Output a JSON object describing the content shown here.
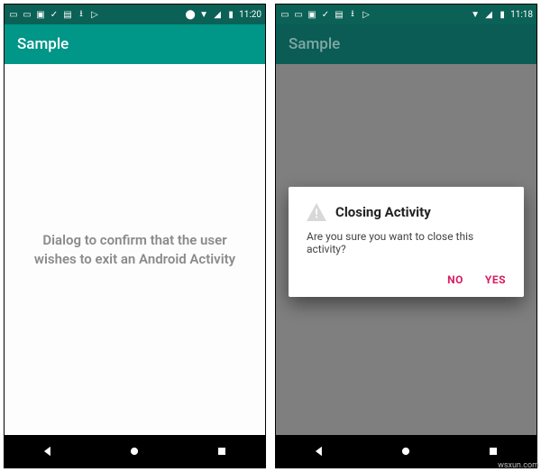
{
  "status": {
    "time": "11:20",
    "time2": "11:18"
  },
  "app_bar": {
    "title": "Sample"
  },
  "left_screen": {
    "message_line1": "Dialog to confirm that the user",
    "message_line2": "wishes to exit an Android Activity"
  },
  "dialog": {
    "title": "Closing Activity",
    "message": "Are you sure you want to close this activity?",
    "no_label": "NO",
    "yes_label": "YES"
  },
  "watermark": "wsxun.com"
}
